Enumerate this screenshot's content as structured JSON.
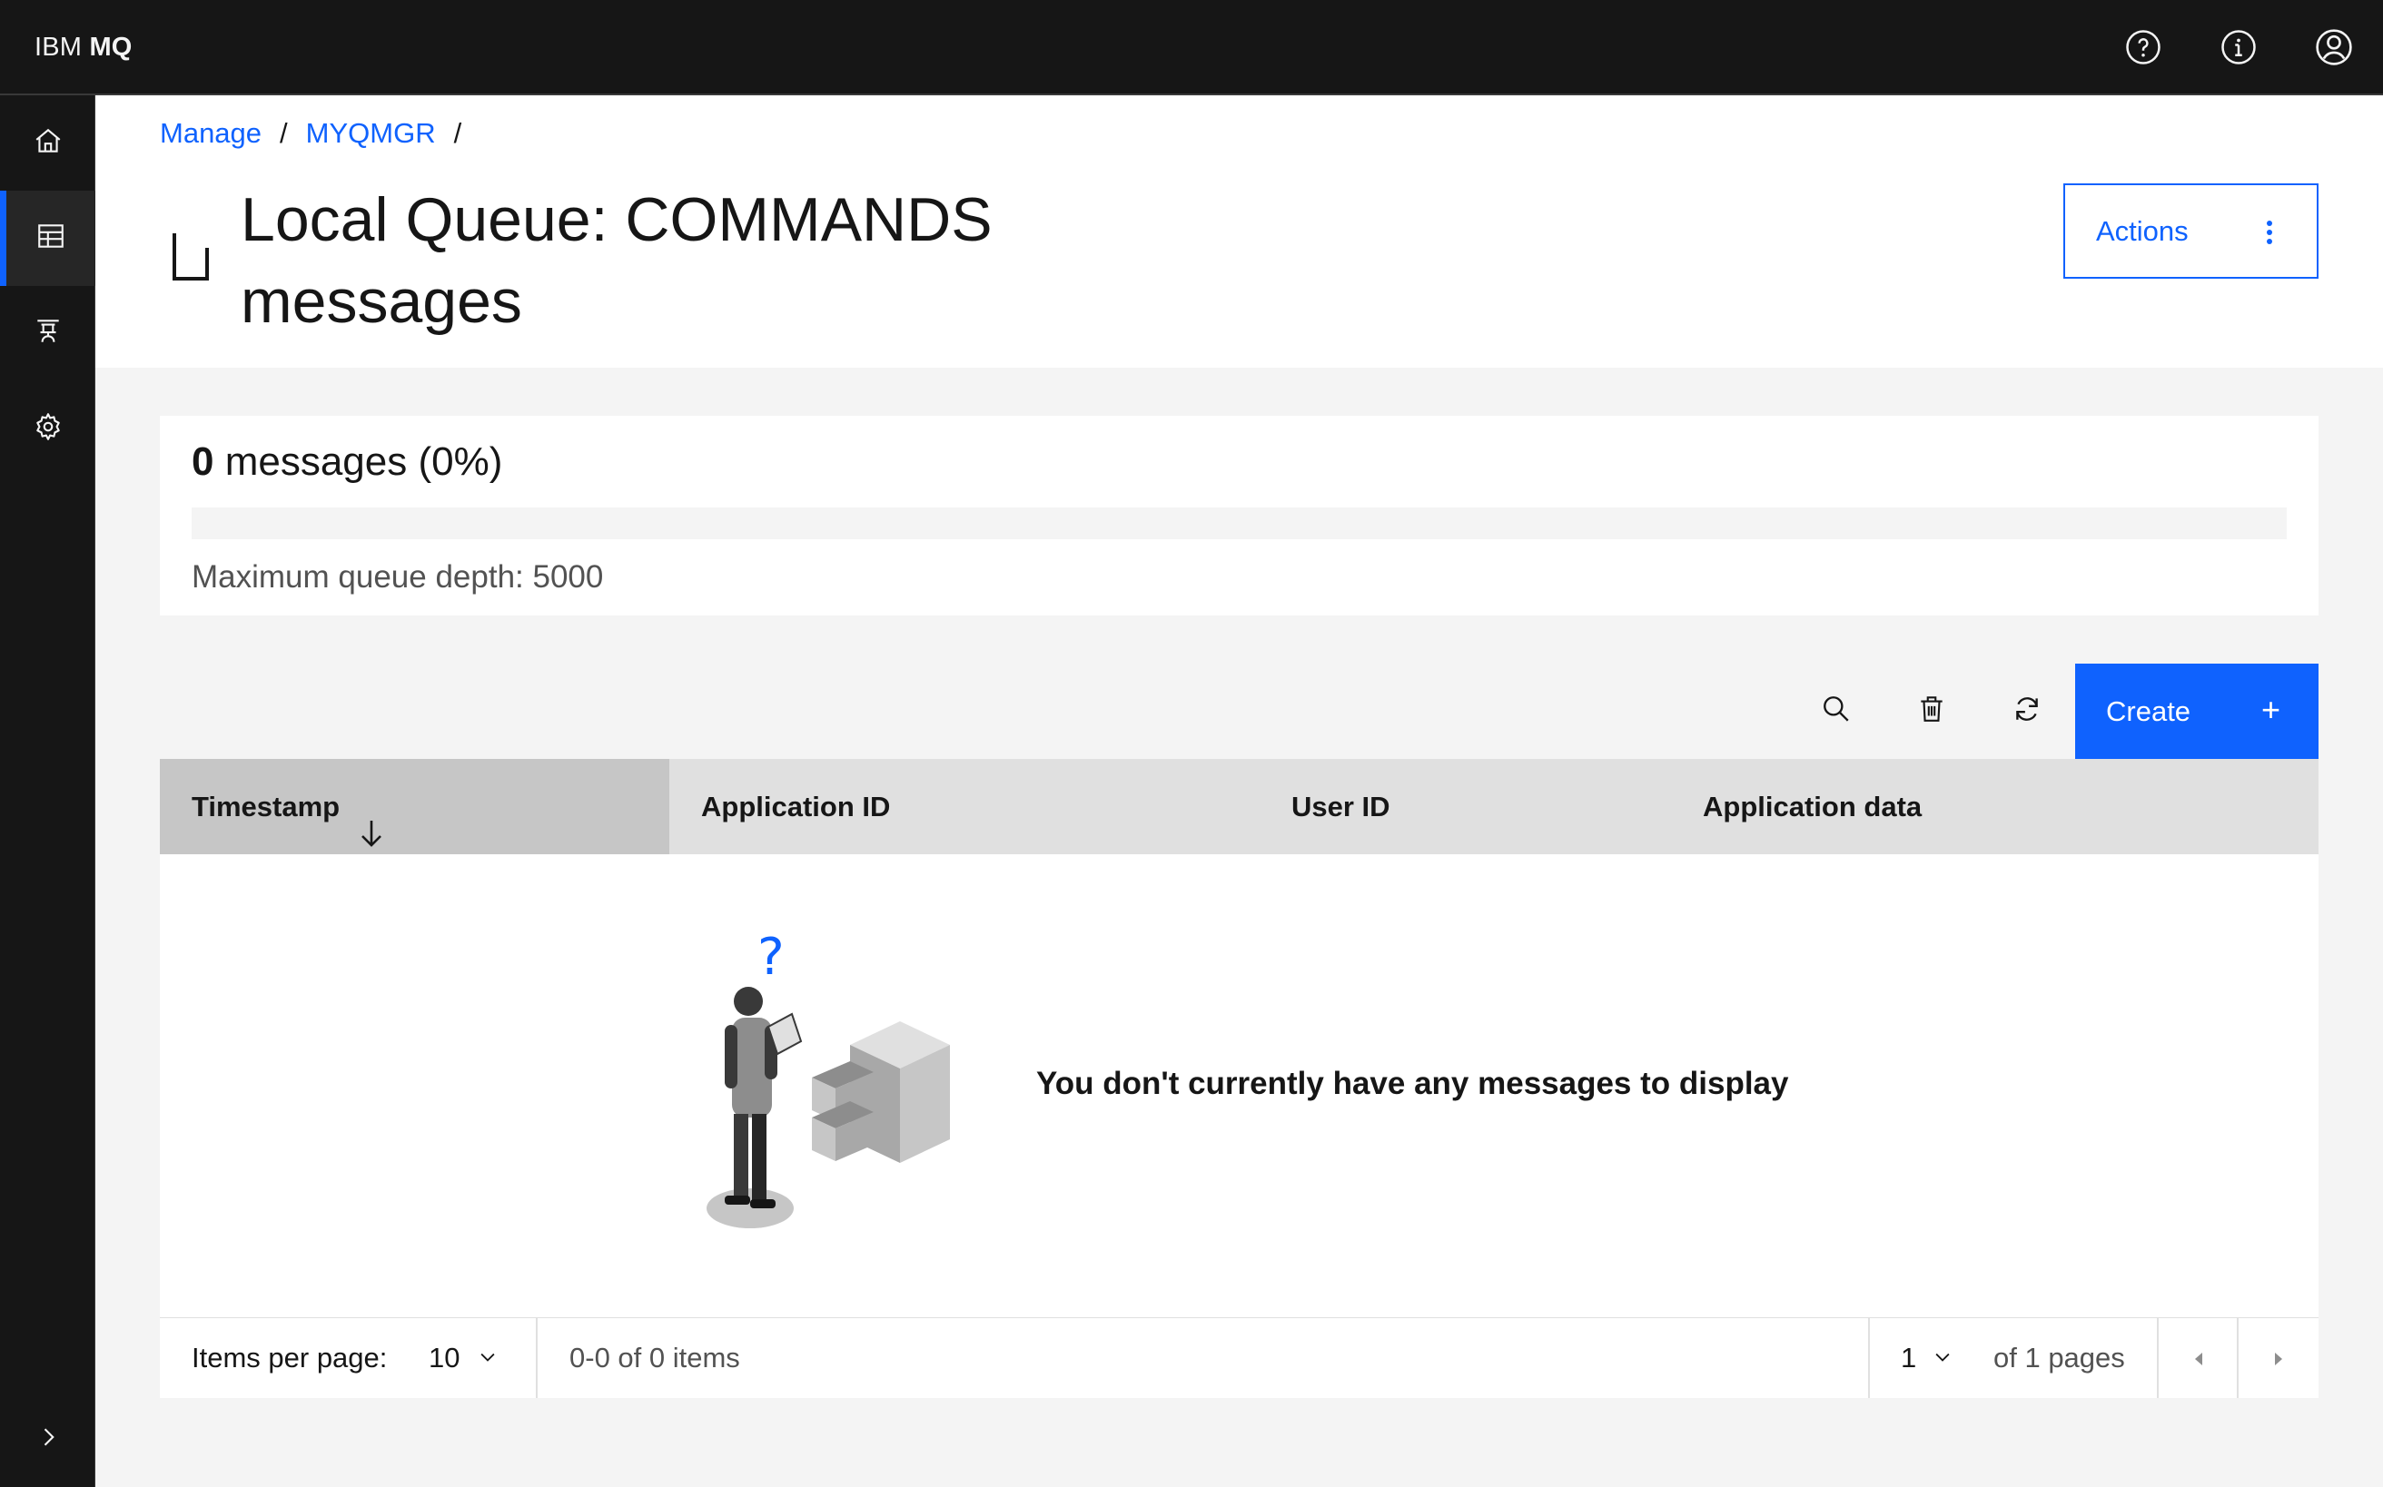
{
  "header": {
    "brand_prefix": "IBM",
    "brand_product": "MQ",
    "icons": [
      "help-icon",
      "info-icon",
      "user-avatar-icon"
    ]
  },
  "siderail": {
    "items": [
      {
        "name": "home",
        "icon": "home-icon",
        "active": false
      },
      {
        "name": "manage",
        "icon": "table-icon",
        "active": true
      },
      {
        "name": "topology",
        "icon": "network-icon",
        "active": false
      },
      {
        "name": "settings",
        "icon": "gear-icon",
        "active": false
      }
    ],
    "expand_icon": "chevron-right-icon"
  },
  "breadcrumb": {
    "items": [
      "Manage",
      "MYQMGR"
    ],
    "separator": "/"
  },
  "page": {
    "title": "Local Queue: COMMANDS messages",
    "actions_label": "Actions"
  },
  "depth": {
    "count": "0",
    "count_suffix": " messages (0%)",
    "fill_percent": 0,
    "max_label": "Maximum queue depth: 5000"
  },
  "toolbar": {
    "create_label": "Create",
    "icons": [
      "search-icon",
      "trash-icon",
      "refresh-icon"
    ]
  },
  "table": {
    "columns": [
      "Timestamp",
      "Application ID",
      "User ID",
      "Application data"
    ],
    "sorted_column": "Timestamp",
    "empty_message": "You don't currently have any messages to display"
  },
  "pagination": {
    "items_per_page_label": "Items per page:",
    "items_per_page": "10",
    "range": "0-0 of 0 items",
    "page": "1",
    "of_pages": "of 1 pages"
  },
  "colors": {
    "accent": "#0f62fe",
    "header_bg": "#161616",
    "page_bg": "#f4f4f4"
  }
}
